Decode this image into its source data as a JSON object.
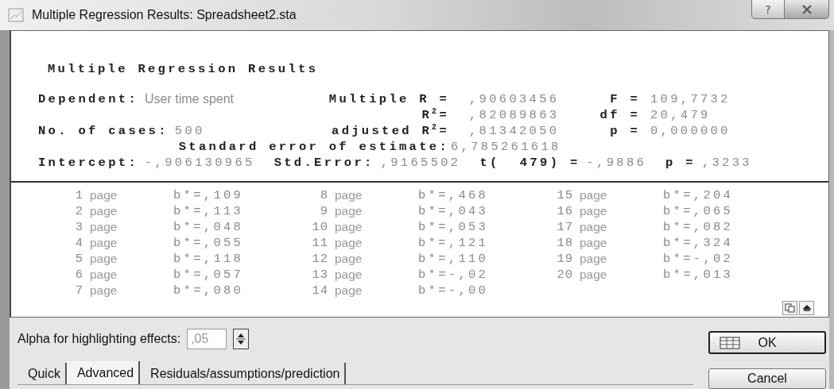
{
  "window": {
    "title": "Multiple Regression Results: Spreadsheet2.sta",
    "help_button": "?"
  },
  "results": {
    "heading": "Multiple Regression Results",
    "dependent": {
      "label": "Dependent:",
      "value": "User time spent"
    },
    "multiple_r": {
      "label": "Multiple R =",
      "value": ",90603456"
    },
    "f": {
      "label": "F =",
      "value": "109,7732"
    },
    "r_squared": {
      "label": "R$^{2}$=",
      "value": ",82089863"
    },
    "df": {
      "label": "df =",
      "value": "20,479"
    },
    "cases": {
      "label": "No. of cases:",
      "value": "500"
    },
    "adjusted_r_squared": {
      "label": "adjusted R$^{2}$=",
      "value": ",81342050"
    },
    "p": {
      "label": "p =",
      "value": "0,000000"
    },
    "standard_error": {
      "label": "Standard error of estimate:",
      "value": "6,785261618"
    },
    "intercept_line": [
      {
        "label": "Intercept:",
        "value": "-,906130965"
      },
      {
        "label": "Std.Error:",
        "value": ",9165502"
      },
      {
        "label": "t(  479) =",
        "value": "-,9886"
      },
      {
        "label": "p =",
        "value": ",3233"
      }
    ],
    "coefficients": [
      {
        "number": "1",
        "name": "page",
        "value": "b*=,109"
      },
      {
        "number": "2",
        "name": "page",
        "value": "b*=,113"
      },
      {
        "number": "3",
        "name": "page",
        "value": "b*=,048"
      },
      {
        "number": "4",
        "name": "page",
        "value": "b*=,055"
      },
      {
        "number": "5",
        "name": "page",
        "value": "b*=,118"
      },
      {
        "number": "6",
        "name": "page",
        "value": "b*=,057"
      },
      {
        "number": "7",
        "name": "page",
        "value": "b*=,080"
      },
      {
        "number": "8",
        "name": "page",
        "value": "b*=,468"
      },
      {
        "number": "9",
        "name": "page",
        "value": "b*=,043"
      },
      {
        "number": "10",
        "name": "page",
        "value": "b*=,053"
      },
      {
        "number": "11",
        "name": "page",
        "value": "b*=,121"
      },
      {
        "number": "12",
        "name": "page",
        "value": "b*=,110"
      },
      {
        "number": "13",
        "name": "page",
        "value": "b*=-,02"
      },
      {
        "number": "14",
        "name": "page",
        "value": "b*=-,00"
      },
      {
        "number": "15",
        "name": "page",
        "value": "b*=,204"
      },
      {
        "number": "16",
        "name": "page",
        "value": "b*=,065"
      },
      {
        "number": "17",
        "name": "page",
        "value": "b*=,082"
      },
      {
        "number": "18",
        "name": "page",
        "value": "b*=,324"
      },
      {
        "number": "19",
        "name": "page",
        "value": "b*=-,02"
      },
      {
        "number": "20",
        "name": "page",
        "value": "b*=,013"
      }
    ]
  },
  "alpha": {
    "label": "Alpha for highlighting effects:",
    "value": ",05"
  },
  "tabs": [
    {
      "label": "Quick",
      "selected": false
    },
    {
      "label": "Advanced",
      "selected": true
    },
    {
      "label": "Residuals/assumptions/prediction",
      "selected": false
    }
  ],
  "buttons": [
    {
      "label": "OK",
      "kind": "default"
    },
    {
      "label": "Cancel",
      "kind": "plain"
    }
  ]
}
